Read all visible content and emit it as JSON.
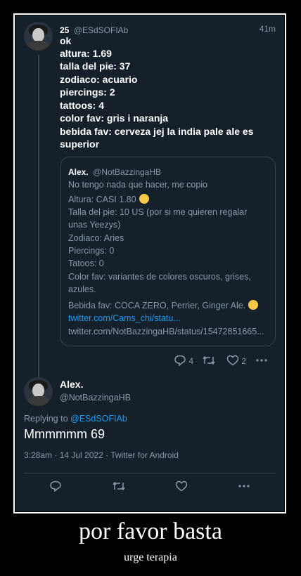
{
  "tweet1": {
    "display_name": "25",
    "handle": "@ESdSOFIAb",
    "time": "41m",
    "lines": [
      "ok",
      "altura: 1.69",
      "talla del pie: 37",
      "zodiaco: acuario",
      "piercings: 2",
      "tattoos: 4",
      "color fav: gris i naranja",
      "bebida fav: cerveza jej la india pale ale es",
      "superior"
    ],
    "quote": {
      "display_name": "Alex.",
      "handle": "@NotBazzingaHB",
      "lines": [
        "No tengo nada que hacer, me copio",
        "Altura: CASI 1.80",
        "Talla del pie: 10 US (por si me quieren regalar",
        "unas Yeezys)",
        "Zodiaco: Aries",
        "Piercings: 0",
        "Tatoos: 0",
        "Color fav: variantes de colores oscuros, grises,",
        "azules.",
        "Bebida fav: COCA ZERO, Perrier, Ginger Ale."
      ],
      "link": "twitter.com/Cams_chi/statu...",
      "url": "twitter.com/NotBazzingaHB/status/15472851665..."
    },
    "actions": {
      "replies": "4",
      "likes": "2"
    }
  },
  "tweet2": {
    "display_name": "Alex.",
    "handle": "@NotBazzingaHB",
    "replying_prefix": "Replying to",
    "replying_handle": "@ESdSOFIAb",
    "text": "Mmmmmm 69",
    "meta": "3:28am · 14 Jul 2022 · Twitter for Android"
  },
  "caption": {
    "title": "por favor basta",
    "subtitle": "urge terapia"
  }
}
